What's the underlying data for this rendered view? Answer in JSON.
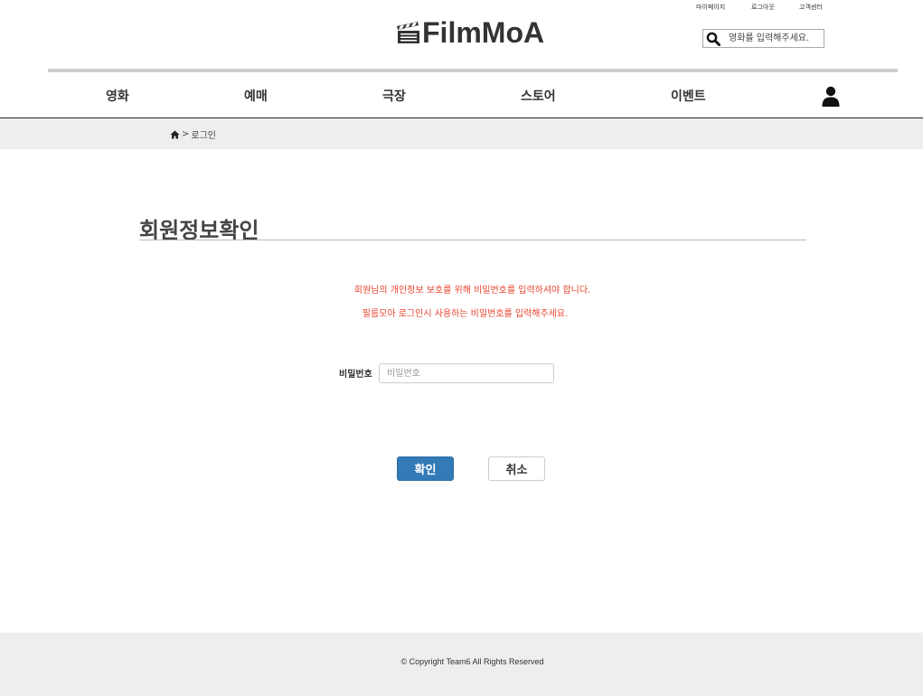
{
  "header": {
    "top_links": [
      "마이페이지",
      "로그아웃",
      "고객센터"
    ],
    "logo_text": "FilmMoA",
    "search_placeholder": "영화를 입력해주세요."
  },
  "nav": {
    "items": [
      "영화",
      "예매",
      "극장",
      "스토어",
      "이벤트"
    ]
  },
  "breadcrumb": {
    "separator": ">",
    "current": "로그인"
  },
  "main": {
    "title": "회원정보확인",
    "notice_1": "회원님의 개인정보 보호를 위해 비밀번호를 입력하셔야 합니다.",
    "notice_2": "필름모아 로그인시 사용하는 비밀번호를 입력해주세요.",
    "password_label": "비밀번호",
    "password_placeholder": "비밀번호",
    "confirm_label": "확인",
    "cancel_label": "취소"
  },
  "footer": {
    "copyright": "© Copyright Team6 All Rights Reserved"
  },
  "colors": {
    "accent": "#337ab7",
    "notice": "#e8442e",
    "band": "#eeeeee"
  }
}
